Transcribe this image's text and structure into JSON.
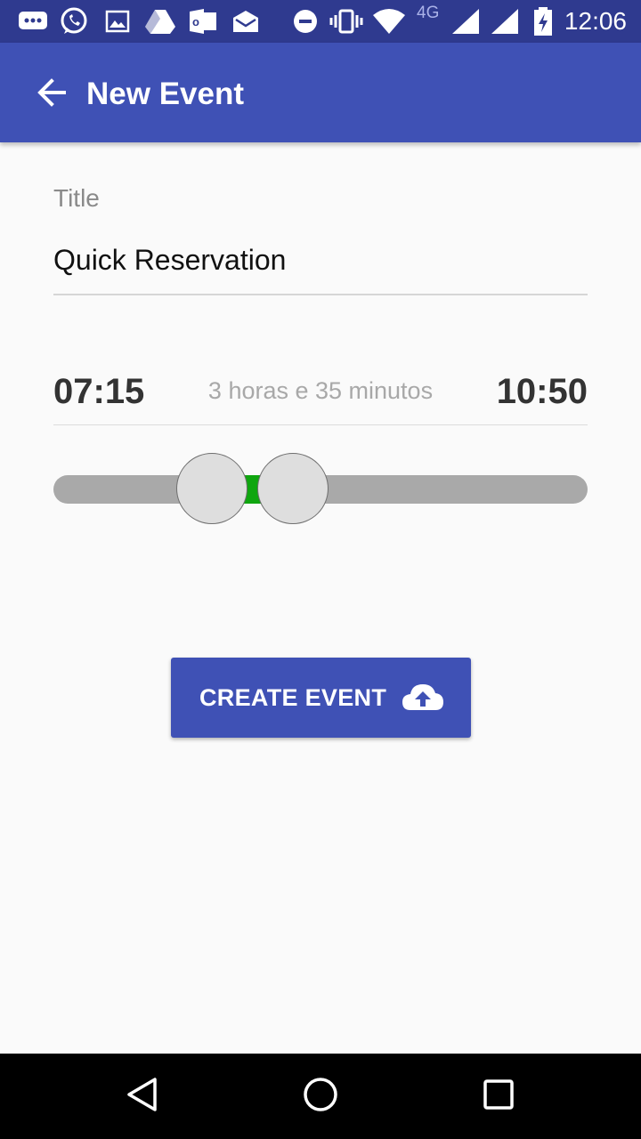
{
  "status_bar": {
    "time": "12:06",
    "network": "4G",
    "icons": [
      "messages-icon",
      "whatsapp-icon",
      "gallery-icon",
      "drive-icon",
      "outlook-icon",
      "mail-icon",
      "do-not-disturb-icon",
      "vibrate-icon",
      "wifi-icon",
      "signal-icon",
      "signal-icon",
      "battery-charging-icon"
    ]
  },
  "app_bar": {
    "title": "New Event",
    "back_icon": "arrow-back-icon"
  },
  "form": {
    "title_label": "Title",
    "title_value": "Quick Reservation",
    "start_time": "07:15",
    "end_time": "10:50",
    "duration": "3 horas e 35 minutos",
    "slider": {
      "start_fraction": 0.297,
      "end_fraction": 0.448,
      "range_color": "#0fa60f",
      "track_color": "#a9a9a9"
    }
  },
  "create_button": {
    "label": "CREATE EVENT",
    "icon": "cloud-upload-icon"
  },
  "colors": {
    "primary": "#3f51b5",
    "primary_dark": "#2f3a8f"
  },
  "nav_bar": {
    "icons": [
      "back-triangle-icon",
      "home-circle-icon",
      "recents-square-icon"
    ]
  }
}
